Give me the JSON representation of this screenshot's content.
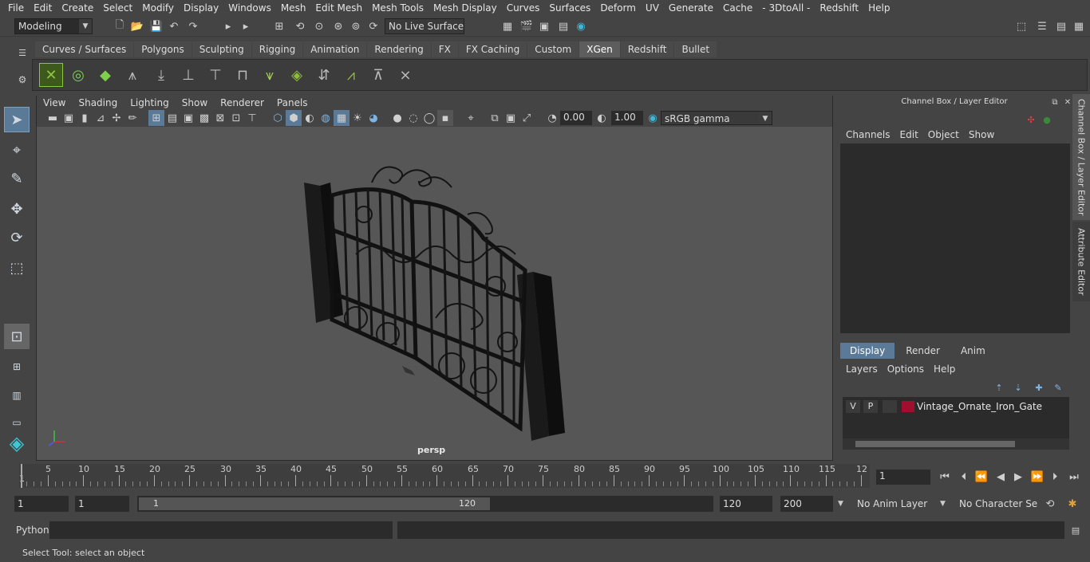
{
  "menu": [
    "File",
    "Edit",
    "Create",
    "Select",
    "Modify",
    "Display",
    "Windows",
    "Mesh",
    "Edit Mesh",
    "Mesh Tools",
    "Mesh Display",
    "Curves",
    "Surfaces",
    "Deform",
    "UV",
    "Generate",
    "Cache",
    "- 3DtoAll -",
    "Redshift",
    "Help"
  ],
  "status": {
    "mode": "Modeling",
    "live_surface": "No Live Surface"
  },
  "shelf_tabs": [
    "Curves / Surfaces",
    "Polygons",
    "Sculpting",
    "Rigging",
    "Animation",
    "Rendering",
    "FX",
    "FX Caching",
    "Custom",
    "XGen",
    "Redshift",
    "Bullet"
  ],
  "shelf_active": "XGen",
  "viewport": {
    "menu": [
      "View",
      "Shading",
      "Lighting",
      "Show",
      "Renderer",
      "Panels"
    ],
    "exposure": "0.00",
    "gamma": "1.00",
    "color_space": "sRGB gamma",
    "camera_label": "persp"
  },
  "channel_box": {
    "title": "Channel Box / Layer Editor",
    "menu": [
      "Channels",
      "Edit",
      "Object",
      "Show"
    ]
  },
  "layer_editor": {
    "tabs": [
      "Display",
      "Render",
      "Anim"
    ],
    "active_tab": "Display",
    "menu": [
      "Layers",
      "Options",
      "Help"
    ],
    "layer": {
      "v": "V",
      "p": "P",
      "name": "Vintage_Ornate_Iron_Gate",
      "color": "#a0102e"
    }
  },
  "side_tabs": [
    "Channel Box / Layer Editor",
    "Attribute Editor"
  ],
  "timeline": {
    "ticks": [
      "5",
      "10",
      "15",
      "20",
      "25",
      "30",
      "35",
      "40",
      "45",
      "50",
      "55",
      "60",
      "65",
      "70",
      "75",
      "80",
      "85",
      "90",
      "95",
      "100",
      "105",
      "110",
      "115",
      "12"
    ],
    "start_marker": "1",
    "current_frame": "1"
  },
  "range": {
    "start": "1",
    "playback_start": "1",
    "slider_start": "1",
    "slider_end": "120",
    "playback_end": "120",
    "end": "200",
    "anim_layer": "No Anim Layer",
    "character_set": "No Character Set"
  },
  "command": {
    "label": "Python"
  },
  "help_line": "Select Tool: select an object"
}
